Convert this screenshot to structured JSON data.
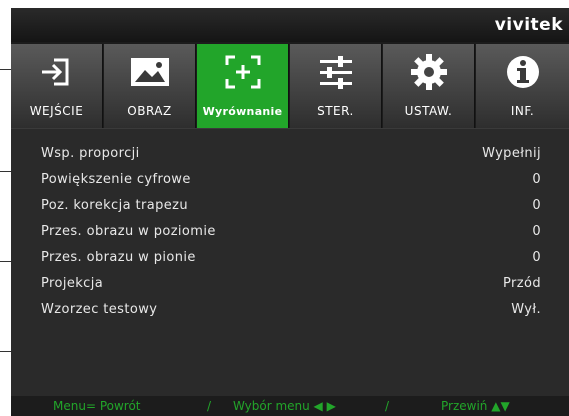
{
  "brand": {
    "logo": "vivitek"
  },
  "colors": {
    "accent": "#22a52a",
    "text": "#e8e8e8",
    "background": "#1c1c1c"
  },
  "tabs": [
    {
      "label": "WEJŚCIE",
      "icon": "input-arrow-icon",
      "active": false
    },
    {
      "label": "OBRAZ",
      "icon": "image-icon",
      "active": false
    },
    {
      "label": "Wyrównanie",
      "icon": "align-icon",
      "active": true
    },
    {
      "label": "STER.",
      "icon": "sliders-icon",
      "active": false
    },
    {
      "label": "USTAW.",
      "icon": "gear-icon",
      "active": false
    },
    {
      "label": "INF.",
      "icon": "info-icon",
      "active": false
    }
  ],
  "menu": {
    "items": [
      {
        "label": "Wsp. proporcji",
        "value": "Wypełnij"
      },
      {
        "label": "Powiększenie cyfrowe",
        "value": "0"
      },
      {
        "label": "Poz. korekcja trapezu",
        "value": "0"
      },
      {
        "label": "Przes. obrazu w poziomie",
        "value": "0"
      },
      {
        "label": "Przes. obrazu w pionie",
        "value": "0"
      },
      {
        "label": "Projekcja",
        "value": "Przód"
      },
      {
        "label": "Wzorzec testowy",
        "value": "Wył."
      }
    ]
  },
  "footer": {
    "back": "Menu= Powrót",
    "sep1": "/",
    "select": "Wybór menu ◀ ▶",
    "sep2": "/",
    "scroll": "Przewiń ▲▼"
  }
}
